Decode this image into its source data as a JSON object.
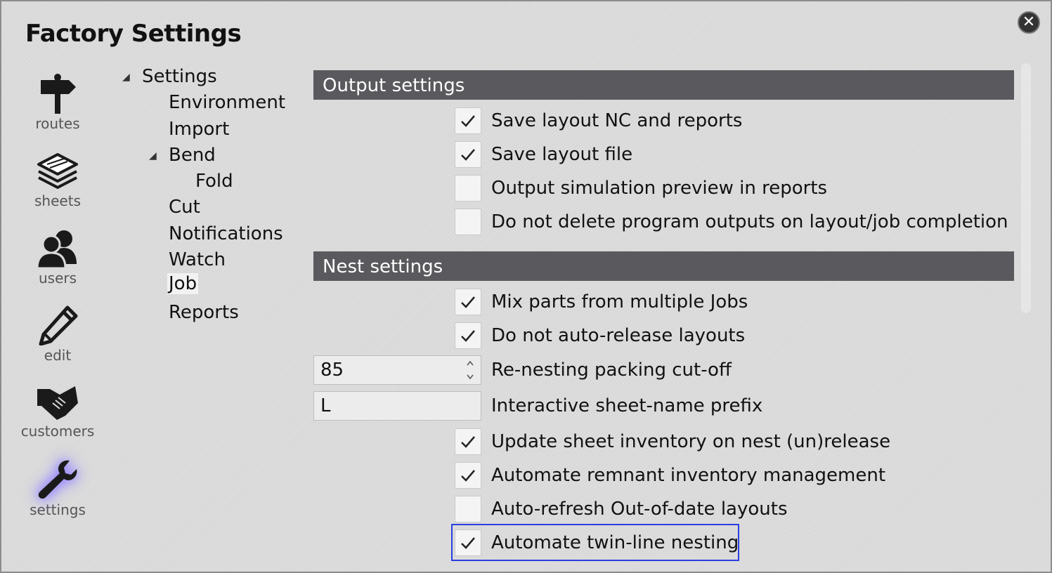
{
  "window": {
    "title": "Factory Settings",
    "close_icon": "close-icon"
  },
  "nav": [
    {
      "label": "routes",
      "icon": "signpost-icon"
    },
    {
      "label": "sheets",
      "icon": "sheets-stack-icon"
    },
    {
      "label": "users",
      "icon": "users-icon"
    },
    {
      "label": "edit",
      "icon": "pencil-icon"
    },
    {
      "label": "customers",
      "icon": "handshake-icon"
    },
    {
      "label": "settings",
      "icon": "wrench-icon",
      "active": true
    }
  ],
  "tree": {
    "root": "Settings",
    "items": [
      "Environment",
      "Import",
      "Bend",
      "Fold",
      "Cut",
      "Notifications",
      "Watch",
      "Job",
      "Reports"
    ],
    "selected": "Job"
  },
  "output_settings": {
    "header": "Output settings",
    "options": [
      {
        "label": "Save layout NC and reports",
        "checked": true
      },
      {
        "label": "Save layout file",
        "checked": true
      },
      {
        "label": "Output simulation preview in reports",
        "checked": false
      },
      {
        "label": "Do not delete program outputs on layout/job completion",
        "checked": false
      }
    ]
  },
  "nest_settings": {
    "header": "Nest settings",
    "options": [
      {
        "label": "Mix parts from multiple Jobs",
        "checked": true
      },
      {
        "label": "Do not auto-release layouts",
        "checked": true
      }
    ],
    "packing_cutoff": {
      "label": "Re-nesting packing cut-off",
      "value": "85"
    },
    "sheet_prefix": {
      "label": "Interactive sheet-name prefix",
      "value": "L"
    },
    "options2": [
      {
        "label": "Update sheet inventory on nest (un)release",
        "checked": true
      },
      {
        "label": "Automate remnant inventory management",
        "checked": true
      },
      {
        "label": "Auto-refresh Out-of-date layouts",
        "checked": false
      },
      {
        "label": "Automate twin-line nesting",
        "checked": true
      }
    ]
  },
  "colors": {
    "header_bg": "#5a5a5e",
    "focus": "#2a3fe0",
    "active_glow": "#8c7cff"
  }
}
